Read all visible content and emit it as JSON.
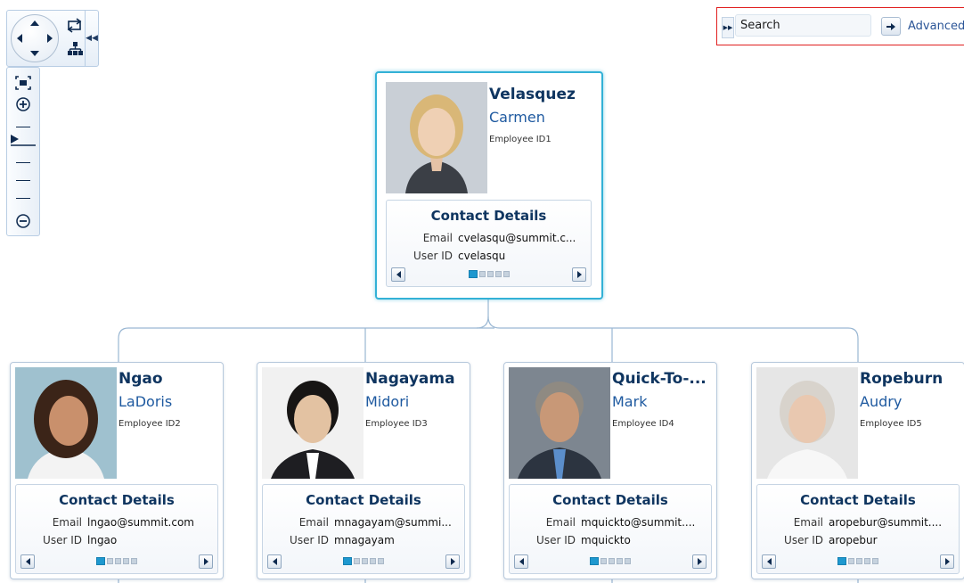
{
  "search": {
    "placeholder": "Search",
    "value": "Search",
    "advanced_label": "Advanced"
  },
  "navigation": {
    "icons": [
      "pan-up-icon",
      "pan-down-icon",
      "pan-left-icon",
      "pan-right-icon",
      "rotate-layout-icon",
      "hierarchy-layout-icon",
      "collapse-panel-icon"
    ],
    "zoom_icons": [
      "zoom-to-fit-icon",
      "zoom-in-icon",
      "zoom-level-marker-icon",
      "zoom-out-icon"
    ]
  },
  "contact_title": "Contact Details",
  "labels": {
    "email": "Email",
    "user_id": "User ID"
  },
  "employees": [
    {
      "last_name": "Velasquez",
      "first_name": "Carmen",
      "employee_id": "Employee ID1",
      "email": "cvelasqu@summit.c...",
      "user_id": "cvelasqu",
      "selected": true,
      "page": 1,
      "pages": 5
    },
    {
      "last_name": "Ngao",
      "first_name": "LaDoris",
      "employee_id": "Employee ID2",
      "email": "lngao@summit.com",
      "user_id": "lngao",
      "page": 1,
      "pages": 5
    },
    {
      "last_name": "Nagayama",
      "first_name": "Midori",
      "employee_id": "Employee ID3",
      "email": "mnagayam@summi...",
      "user_id": "mnagayam",
      "page": 1,
      "pages": 5
    },
    {
      "last_name": "Quick-To-...",
      "first_name": "Mark",
      "employee_id": "Employee ID4",
      "email": "mquickto@summit....",
      "user_id": "mquickto",
      "page": 1,
      "pages": 5
    },
    {
      "last_name": "Ropeburn",
      "first_name": "Audry",
      "employee_id": "Employee ID5",
      "email": "aropebur@summit....",
      "user_id": "aropebur",
      "page": 1,
      "pages": 5
    }
  ],
  "colors": {
    "selected_border": "#33b1d6",
    "card_border": "#b7c9dc",
    "title_navy": "#0f3560",
    "firstname_blue": "#1f5aa0",
    "connector": "#9ab7d3",
    "search_frame": "#e02020"
  }
}
